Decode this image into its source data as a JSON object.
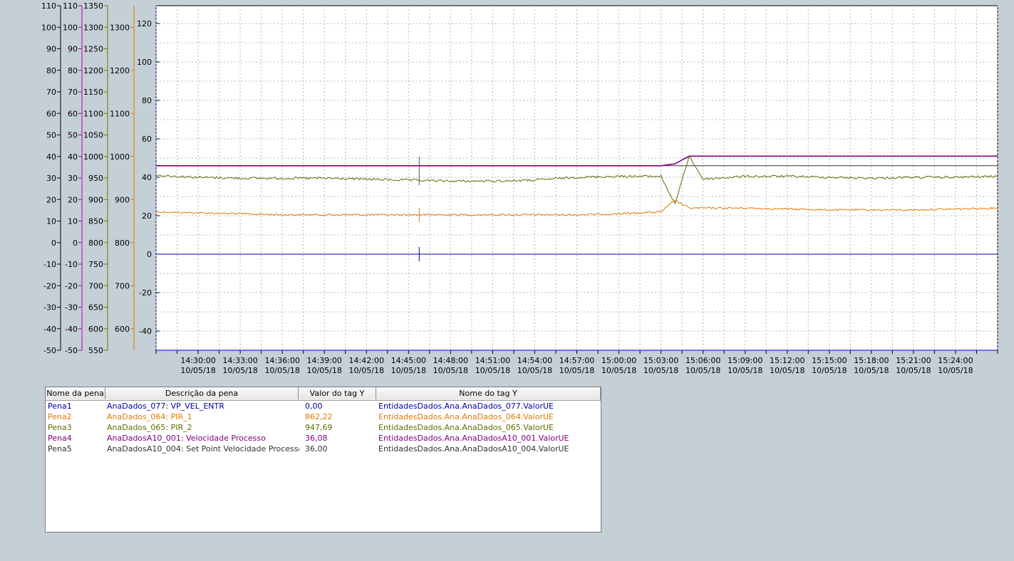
{
  "chart_data": {
    "type": "line",
    "x": [
      "14:27:00",
      "14:30:00",
      "14:33:00",
      "14:36:00",
      "14:39:00",
      "14:42:00",
      "14:45:00",
      "14:48:00",
      "14:51:00",
      "14:54:00",
      "14:57:00",
      "15:00:00",
      "15:03:00",
      "15:04:00",
      "15:05:00",
      "15:06:00",
      "15:09:00",
      "15:12:00",
      "15:15:00",
      "15:18:00",
      "15:21:00",
      "15:24:00",
      "15:27:00"
    ],
    "x_ticks": [
      {
        "time": "14:30:00",
        "date": "10/05/18"
      },
      {
        "time": "14:33:00",
        "date": "10/05/18"
      },
      {
        "time": "14:36:00",
        "date": "10/05/18"
      },
      {
        "time": "14:39:00",
        "date": "10/05/18"
      },
      {
        "time": "14:42:00",
        "date": "10/05/18"
      },
      {
        "time": "14:45:00",
        "date": "10/05/18"
      },
      {
        "time": "14:48:00",
        "date": "10/05/18"
      },
      {
        "time": "14:51:00",
        "date": "10/05/18"
      },
      {
        "time": "14:54:00",
        "date": "10/05/18"
      },
      {
        "time": "14:57:00",
        "date": "10/05/18"
      },
      {
        "time": "15:00:00",
        "date": "10/05/18"
      },
      {
        "time": "15:03:00",
        "date": "10/05/18"
      },
      {
        "time": "15:06:00",
        "date": "10/05/18"
      },
      {
        "time": "15:09:00",
        "date": "10/05/18"
      },
      {
        "time": "15:12:00",
        "date": "10/05/18"
      },
      {
        "time": "15:15:00",
        "date": "10/05/18"
      },
      {
        "time": "15:18:00",
        "date": "10/05/18"
      },
      {
        "time": "15:21:00",
        "date": "10/05/18"
      },
      {
        "time": "15:24:00",
        "date": "10/05/18"
      }
    ],
    "axes": [
      {
        "name": "axis-1",
        "color": "#000000",
        "ticks": [
          110,
          100,
          90,
          80,
          70,
          60,
          50,
          40,
          30,
          20,
          10,
          0,
          -10,
          -20,
          -30,
          -40,
          -50
        ]
      },
      {
        "name": "axis-2",
        "color": "#b000b0",
        "ticks": [
          110,
          100,
          90,
          80,
          70,
          60,
          50,
          40,
          30,
          20,
          10,
          0,
          -10,
          -20,
          -30,
          -40,
          -50
        ]
      },
      {
        "name": "axis-3",
        "color": "#6b7a00",
        "ticks": [
          1350,
          1300,
          1250,
          1200,
          1150,
          1100,
          1050,
          1000,
          950,
          900,
          850,
          800,
          750,
          700,
          650,
          600,
          550
        ]
      },
      {
        "name": "axis-4",
        "color": "#e07800",
        "ticks": [
          1300,
          1200,
          1100,
          1000,
          900,
          800,
          700,
          600
        ],
        "ylim": [
          550,
          1350
        ]
      },
      {
        "name": "axis-5",
        "color": "#000000",
        "ticks": [
          120,
          100,
          80,
          60,
          40,
          20,
          0,
          -20,
          -40
        ],
        "ylim": [
          -50,
          130
        ]
      }
    ],
    "grid": true,
    "series": [
      {
        "name": "Pena1",
        "color": "#0000aa",
        "axis": "axis-5",
        "values": [
          0,
          0,
          0,
          0,
          0,
          0,
          0,
          0,
          0,
          0,
          0,
          0,
          0,
          0,
          0,
          0,
          0,
          0,
          0,
          0,
          0,
          0,
          0
        ]
      },
      {
        "name": "Pena2",
        "color": "#e07800",
        "axis": "axis-5",
        "values": [
          22,
          21.5,
          21,
          20.5,
          20.5,
          20.5,
          20.5,
          20.5,
          20.5,
          20.5,
          20.5,
          21,
          22,
          28,
          24,
          24,
          24,
          23.5,
          23,
          23,
          23,
          23.5,
          24
        ]
      },
      {
        "name": "Pena3",
        "color": "#5a6e00",
        "axis": "axis-5",
        "values": [
          41,
          40,
          39.5,
          39.5,
          39.5,
          39,
          38.5,
          38,
          38,
          38.5,
          40,
          40.5,
          40.5,
          26,
          51,
          39,
          40.5,
          40.5,
          40,
          39.5,
          40,
          40,
          40.5
        ]
      },
      {
        "name": "Pena4",
        "color": "#800080",
        "axis": "axis-5",
        "values": [
          46,
          46,
          46,
          46,
          46,
          46,
          46,
          46,
          46,
          46,
          46,
          46,
          46,
          47,
          51,
          51,
          51,
          51,
          51,
          51,
          51,
          51,
          51
        ]
      },
      {
        "name": "Pena5",
        "color": "#333333",
        "axis": "axis-5",
        "values": [
          46,
          46,
          46,
          46,
          46,
          46,
          46,
          46,
          46,
          46,
          46,
          46,
          46,
          46,
          46,
          46,
          46,
          46,
          46,
          46,
          46,
          46,
          46
        ]
      }
    ]
  },
  "pen_table": {
    "headers": [
      "Nome da pena",
      "Descrição da pena",
      "Valor do tag Y",
      "Nome do tag Y"
    ],
    "rows": [
      {
        "name": "Pena1",
        "desc": "AnaDados_077: VP_VEL_ENTR",
        "value": "0,00",
        "tag": "EntidadesDados.Ana.AnaDados_077.ValorUE",
        "color": "#0000aa"
      },
      {
        "name": "Pena2",
        "desc": "AnaDados_064: PIR_1",
        "value": "862,22",
        "tag": "EntidadesDados.Ana.AnaDados_064.ValorUE",
        "color": "#e07800"
      },
      {
        "name": "Pena3",
        "desc": "AnaDados_065: PIR_2",
        "value": "947,69",
        "tag": "EntidadesDados.Ana.AnaDados_065.ValorUE",
        "color": "#5a6e00"
      },
      {
        "name": "Pena4",
        "desc": "AnaDadosA10_001: Velocidade Processo",
        "value": "36,08",
        "tag": "EntidadesDados.Ana.AnaDadosA10_001.ValorUE",
        "color": "#800080"
      },
      {
        "name": "Pena5",
        "desc": "AnaDadosA10_004: Set Point Velocidade Processo",
        "value": "36,00",
        "tag": "EntidadesDados.Ana.AnaDadosA10_004.ValorUE",
        "color": "#333333"
      }
    ]
  }
}
